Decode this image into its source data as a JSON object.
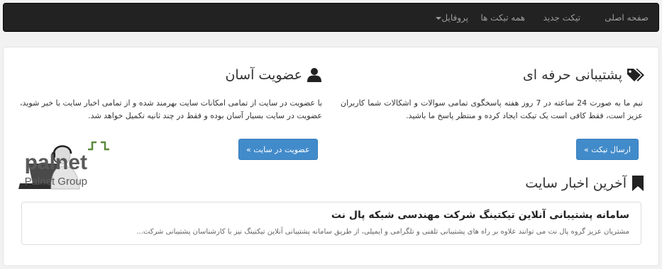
{
  "nav": {
    "home": "صفحه اصلی",
    "new_ticket": "تیکت جدید",
    "all_tickets": "همه تیکت ها",
    "profile": "پروفایل"
  },
  "support": {
    "title": "پشتیبانی حرفه ای",
    "text": "تیم ما به صورت 24 ساعته در 7 روز هفته پاسخگوی تمامی سوالات و اشکالات شما کاربران عزیز است، فقط کافی است یک تیکت ایجاد کرده و منتظر پاسخ ما باشید.",
    "button": "ارسال تیکت »"
  },
  "membership": {
    "title": "عضویت آسان",
    "text": "با عضویت در سایت از تمامی امکانات سایت بهرمند شده و از تمامی اخبار سایت با خبر شوید، عضویت در سایت بسیار آسان بوده و فقط در چند ثانیه تکمیل خواهد شد.",
    "button": "عضویت در سایت »"
  },
  "logo": {
    "brand": "palnet",
    "subtitle": "Palnet Group"
  },
  "news": {
    "heading": "آخرین اخبار سایت",
    "items": [
      {
        "title": "سامانه پشتیبانی آنلاین تیکتینگ شرکت مهندسی شبکه پال نت",
        "summary": "مشتریان عزیز گروه پال نت می توانند علاوه بر راه های پشتیبانی تلفنی و تلگرامی و ایمیلی، از طریق سامانه پشتیبانی آنلاین تیکتینگ نیز با کارشناسان پشتیبانی شرکت..."
      }
    ]
  },
  "colors": {
    "navbar": "#222222",
    "nav_text": "#9d9d9d",
    "primary_button": "#428bca",
    "logo_green": "#5a8a3c",
    "logo_gray": "#5a5a5a"
  }
}
